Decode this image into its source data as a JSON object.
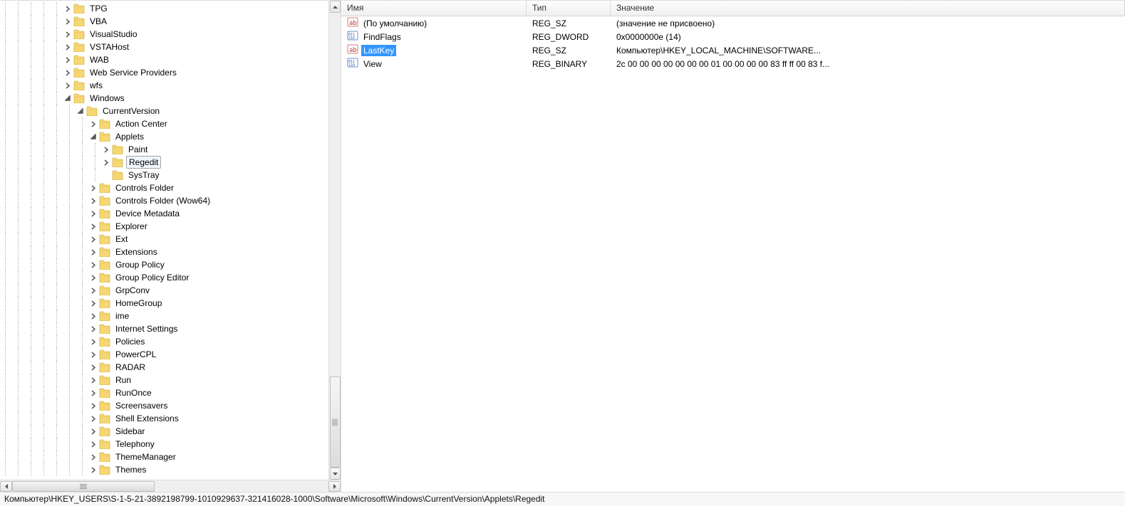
{
  "columns": {
    "name": "Имя",
    "type": "Тип",
    "value": "Значение"
  },
  "values": [
    {
      "icon": "string",
      "name": "(По умолчанию)",
      "type": "REG_SZ",
      "value": "(значение не присвоено)",
      "selected": false
    },
    {
      "icon": "binary",
      "name": "FindFlags",
      "type": "REG_DWORD",
      "value": "0x0000000e (14)",
      "selected": false
    },
    {
      "icon": "string",
      "name": "LastKey",
      "type": "REG_SZ",
      "value": "Компьютер\\HKEY_LOCAL_MACHINE\\SOFTWARE...",
      "selected": true
    },
    {
      "icon": "binary",
      "name": "View",
      "type": "REG_BINARY",
      "value": "2c 00 00 00 00 00 00 00 01 00 00 00 00 83 ff ff 00 83 f...",
      "selected": false
    }
  ],
  "statusbar": "Компьютер\\HKEY_USERS\\S-1-5-21-3892198799-1010929637-321416028-1000\\Software\\Microsoft\\Windows\\CurrentVersion\\Applets\\Regedit",
  "tree": [
    {
      "depth": 5,
      "toggle": "closed",
      "label": "TPG"
    },
    {
      "depth": 5,
      "toggle": "closed",
      "label": "VBA"
    },
    {
      "depth": 5,
      "toggle": "closed",
      "label": "VisualStudio"
    },
    {
      "depth": 5,
      "toggle": "closed",
      "label": "VSTAHost"
    },
    {
      "depth": 5,
      "toggle": "closed",
      "label": "WAB"
    },
    {
      "depth": 5,
      "toggle": "closed",
      "label": "Web Service Providers"
    },
    {
      "depth": 5,
      "toggle": "closed",
      "label": "wfs"
    },
    {
      "depth": 5,
      "toggle": "open",
      "label": "Windows"
    },
    {
      "depth": 6,
      "toggle": "open",
      "label": "CurrentVersion"
    },
    {
      "depth": 7,
      "toggle": "closed",
      "label": "Action Center"
    },
    {
      "depth": 7,
      "toggle": "open",
      "label": "Applets"
    },
    {
      "depth": 8,
      "toggle": "closed",
      "label": "Paint"
    },
    {
      "depth": 8,
      "toggle": "closed",
      "label": "Regedit",
      "selected": true
    },
    {
      "depth": 8,
      "toggle": "none",
      "label": "SysTray"
    },
    {
      "depth": 7,
      "toggle": "closed",
      "label": "Controls Folder"
    },
    {
      "depth": 7,
      "toggle": "closed",
      "label": "Controls Folder (Wow64)"
    },
    {
      "depth": 7,
      "toggle": "closed",
      "label": "Device Metadata"
    },
    {
      "depth": 7,
      "toggle": "closed",
      "label": "Explorer"
    },
    {
      "depth": 7,
      "toggle": "closed",
      "label": "Ext"
    },
    {
      "depth": 7,
      "toggle": "closed",
      "label": "Extensions"
    },
    {
      "depth": 7,
      "toggle": "closed",
      "label": "Group Policy"
    },
    {
      "depth": 7,
      "toggle": "closed",
      "label": "Group Policy Editor"
    },
    {
      "depth": 7,
      "toggle": "closed",
      "label": "GrpConv"
    },
    {
      "depth": 7,
      "toggle": "closed",
      "label": "HomeGroup"
    },
    {
      "depth": 7,
      "toggle": "closed",
      "label": "ime"
    },
    {
      "depth": 7,
      "toggle": "closed",
      "label": "Internet Settings"
    },
    {
      "depth": 7,
      "toggle": "closed",
      "label": "Policies"
    },
    {
      "depth": 7,
      "toggle": "closed",
      "label": "PowerCPL"
    },
    {
      "depth": 7,
      "toggle": "closed",
      "label": "RADAR"
    },
    {
      "depth": 7,
      "toggle": "closed",
      "label": "Run"
    },
    {
      "depth": 7,
      "toggle": "closed",
      "label": "RunOnce"
    },
    {
      "depth": 7,
      "toggle": "closed",
      "label": "Screensavers"
    },
    {
      "depth": 7,
      "toggle": "closed",
      "label": "Shell Extensions"
    },
    {
      "depth": 7,
      "toggle": "closed",
      "label": "Sidebar"
    },
    {
      "depth": 7,
      "toggle": "closed",
      "label": "Telephony"
    },
    {
      "depth": 7,
      "toggle": "closed",
      "label": "ThemeManager"
    },
    {
      "depth": 7,
      "toggle": "closed",
      "label": "Themes"
    }
  ]
}
